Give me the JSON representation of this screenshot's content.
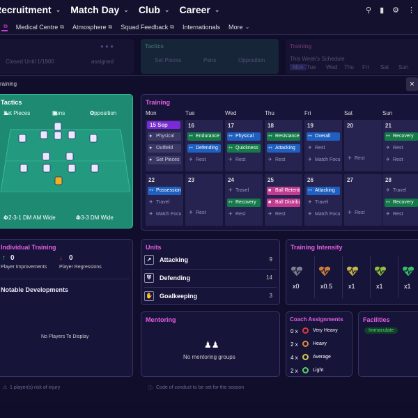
{
  "topnav": {
    "items": [
      "Recruitment",
      "Match Day",
      "Club",
      "Career"
    ],
    "icons": [
      "search-icon",
      "inbox-icon",
      "settings-icon",
      "more-icon"
    ]
  },
  "subnav": {
    "items": [
      "Medical Centre",
      "Atmosphere",
      "Squad Feedback",
      "Internationals"
    ],
    "more": "More"
  },
  "background": {
    "left_text": "Closed Until 1/1900",
    "left_text2": "assigned",
    "tactics_title": "Tactics",
    "tactics_tabs": [
      "Set Pieces",
      "Pens",
      "Opposition"
    ],
    "training_title": "Training",
    "training_sub": "This Week's Schedule",
    "training_days": [
      "Mon",
      "Tue",
      "Wed",
      "Thu",
      "Fri",
      "Sat",
      "Sun"
    ]
  },
  "overlay": {
    "title": "raining",
    "close": "×"
  },
  "tactics": {
    "title": "Tactics",
    "tabs": [
      "Set Pieces",
      "Pens",
      "Opposition"
    ],
    "formations": [
      "4-2-3-1 DM AM Wide",
      "4-3-3 DM Wide"
    ]
  },
  "training": {
    "title": "Training",
    "days": [
      "Mon",
      "Tue",
      "Wed",
      "Thu",
      "Fri",
      "Sat",
      "Sun"
    ],
    "week1": {
      "dates": [
        "15 Sep",
        "16",
        "17",
        "18",
        "19",
        "20",
        "21"
      ],
      "mon": [
        "Physical",
        "Outfield",
        "Set Pieces"
      ],
      "tue": [
        "Endurance",
        "Defending",
        "Rest"
      ],
      "wed": [
        "Physical",
        "Quickness",
        "Rest"
      ],
      "thu": [
        "Resistance",
        "Attacking",
        "Rest"
      ],
      "fri": [
        "Overall",
        "Rest",
        "Match Focus"
      ],
      "sat": [
        "Rest"
      ],
      "sun": [
        "Recovery",
        "Rest",
        "Rest"
      ]
    },
    "week2": {
      "dates": [
        "22",
        "23",
        "24",
        "25",
        "26",
        "27",
        "28"
      ],
      "mon": [
        "Possession",
        "Travel",
        "Match Focus"
      ],
      "tue": [
        "Rest"
      ],
      "wed": [
        "Travel",
        "Recovery",
        "Rest"
      ],
      "thu": [
        "Ball Retention",
        "Ball Distribution",
        "Rest"
      ],
      "fri": [
        "Attacking",
        "Travel",
        "Match Focus"
      ],
      "sat": [
        "Rest"
      ],
      "sun": [
        "Travel",
        "Recovery",
        "Rest"
      ]
    }
  },
  "individual": {
    "title": "Individual Training",
    "improvements": "0",
    "improvements_label": "Player Improvements",
    "regressions": "0",
    "regressions_label": "Player Regressions",
    "notable_title": "Notable Developments",
    "empty": "No Players To Display"
  },
  "units": {
    "title": "Units",
    "rows": [
      {
        "label": "Attacking",
        "count": "9"
      },
      {
        "label": "Defending",
        "count": "14"
      },
      {
        "label": "Goalkeeping",
        "count": "3"
      }
    ]
  },
  "intensity": {
    "title": "Training Intensity",
    "levels": [
      "x0",
      "x0.5",
      "x1",
      "x1",
      "x1"
    ],
    "colors": [
      "#8a8a9a",
      "#e08a3a",
      "#d8c84a",
      "#9bd23a",
      "#3ad26a"
    ]
  },
  "mentoring": {
    "title": "Mentoring",
    "empty": "No mentoring groups"
  },
  "coach": {
    "title": "Coach Assignments",
    "rows": [
      {
        "count": "0 x",
        "label": "Very Heavy",
        "color": "#e03a3a"
      },
      {
        "count": "2 x",
        "label": "Heavy",
        "color": "#e08a3a"
      },
      {
        "count": "4 x",
        "label": "Average",
        "color": "#d8c84a"
      },
      {
        "count": "2 x",
        "label": "Light",
        "color": "#5ad26a"
      }
    ]
  },
  "facilities": {
    "title": "Facilities",
    "badge": "Immaculate"
  },
  "bottom": {
    "left": "1 player(s) risk of injury",
    "right": "Code of conduct to be set for the season"
  }
}
